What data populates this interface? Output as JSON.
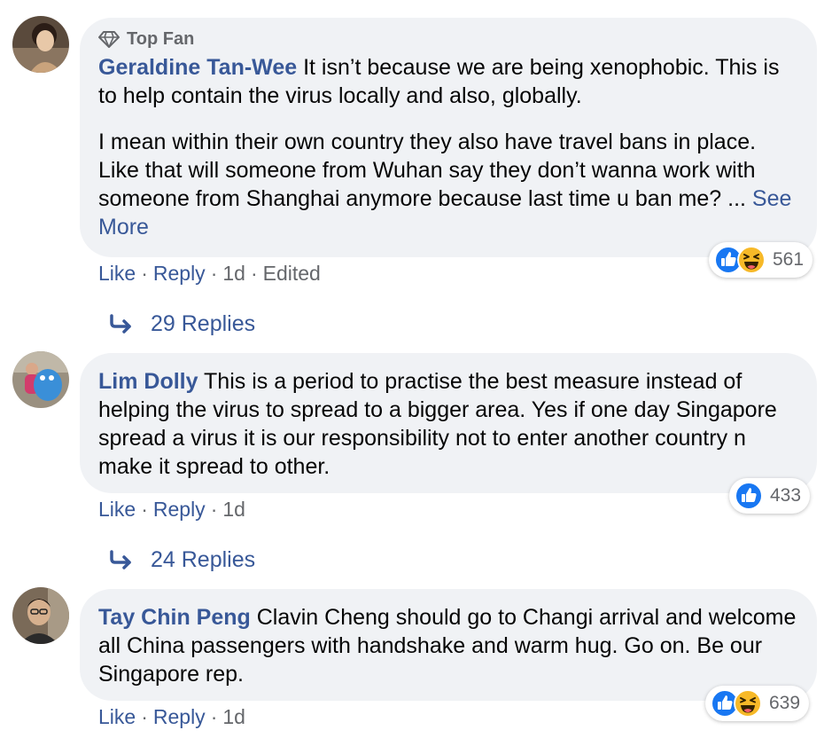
{
  "comments": [
    {
      "badge": "Top Fan",
      "author": "Geraldine Tan-Wee",
      "text1": "It isn’t because we are being xenophobic. This is to help contain the virus locally and also, globally.",
      "text2": "I mean within their own country they also have travel bans in place. Like that will someone from Wuhan say they don’t wanna work with someone from Shanghai anymore because last time u ban me? ...",
      "see_more": "See More",
      "like": "Like",
      "reply": "Reply",
      "time": "1d",
      "edited": "Edited",
      "reaction_count": "561",
      "replies_label": "29 Replies"
    },
    {
      "author": "Lim Dolly",
      "text1": "This is a period to practise the best measure instead of helping the virus to spread to a bigger area. Yes if one day Singapore spread a virus it is our responsibility not to enter another country n make it spread to other.",
      "like": "Like",
      "reply": "Reply",
      "time": "1d",
      "reaction_count": "433",
      "replies_label": "24 Replies"
    },
    {
      "author": "Tay Chin Peng",
      "text1": "Clavin Cheng should go to Changi arrival and welcome all China passengers with handshake and warm hug. Go on. Be our Singapore rep.",
      "like": "Like",
      "reply": "Reply",
      "time": "1d",
      "reaction_count": "639"
    }
  ],
  "separator": "·",
  "icons": {
    "badge": "diamond-icon",
    "reply_arrow": "reply-arrow-icon",
    "like_reaction": "like-reaction-icon",
    "haha_reaction": "haha-reaction-icon"
  },
  "colors": {
    "link": "#385898",
    "bubble": "#f0f2f5",
    "meta": "#65676b",
    "like": "#1877f2",
    "haha": "#f7b928"
  }
}
